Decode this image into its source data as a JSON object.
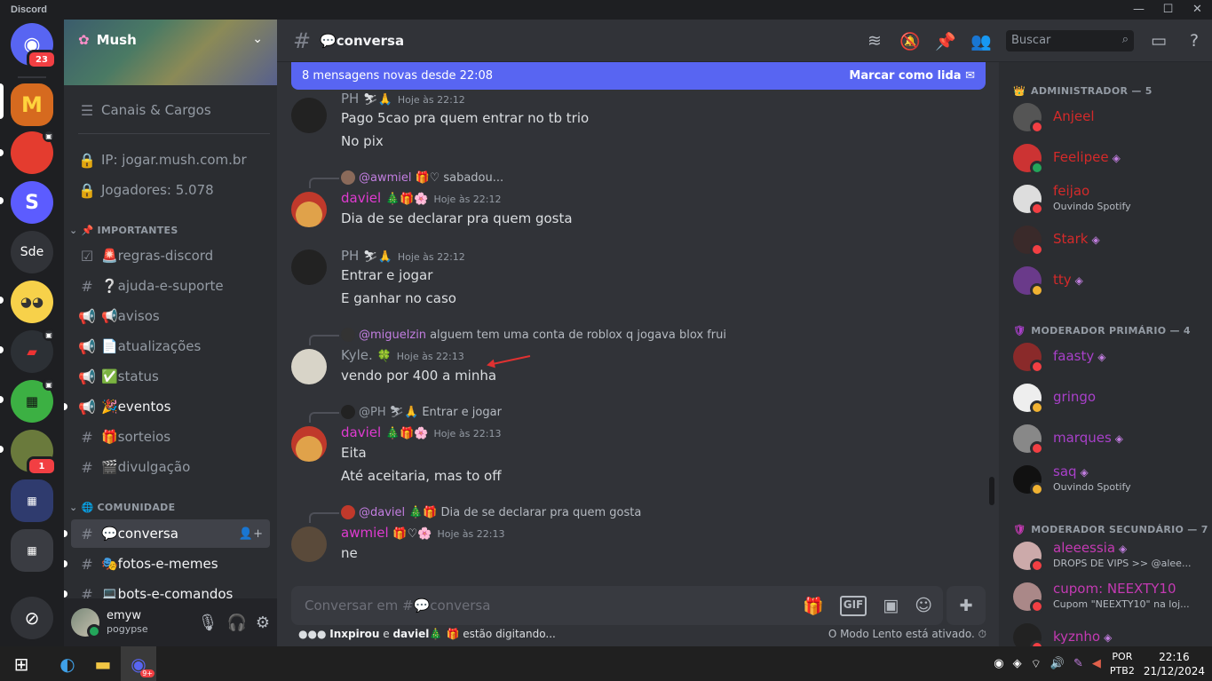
{
  "app": {
    "title": "Discord",
    "window_controls": [
      "—",
      "☐",
      "✕"
    ]
  },
  "rail": {
    "home_badge": "23",
    "servers": [
      {
        "name": "Mush",
        "label": "M",
        "color": "#e8a33b"
      },
      {
        "name": "server-red",
        "label": "",
        "color": "#e43c2f"
      },
      {
        "name": "server-s",
        "label": "S",
        "color": "#5c5cff"
      },
      {
        "name": "Sde",
        "label": "Sde",
        "color": "#313338"
      },
      {
        "name": "server-emoji",
        "label": "",
        "color": "#f7d14a"
      },
      {
        "name": "server-dark-red",
        "label": "",
        "color": "#3b3f45"
      },
      {
        "name": "server-creeper",
        "label": "",
        "color": "#3cb043"
      },
      {
        "name": "server-wild",
        "label": "",
        "color": "#6a7a3c",
        "badge": "1"
      },
      {
        "name": "server-folder-1",
        "label": "",
        "color": "#2f3b6e"
      },
      {
        "name": "server-folder-2",
        "label": "",
        "color": "#2b2d31"
      },
      {
        "name": "explore",
        "label": "",
        "color": "#313338"
      }
    ]
  },
  "server": {
    "name": "Mush",
    "channels_roles": "Canais & Cargos",
    "ip": "IP: jogar.mush.com.br",
    "players": "Jogadores: 5.078",
    "categories": [
      {
        "name": "IMPORTANTES",
        "emoji": "📌"
      },
      {
        "name": "COMUNIDADE",
        "emoji": "🌐"
      }
    ],
    "important_channels": [
      {
        "icon": "☑",
        "name": "🚨regras-discord"
      },
      {
        "icon": "#",
        "name": "❔ajuda-e-suporte"
      },
      {
        "icon": "📢",
        "name": "📢avisos"
      },
      {
        "icon": "📢",
        "name": "📄atualizações"
      },
      {
        "icon": "📢",
        "name": "✅status"
      },
      {
        "icon": "📢",
        "name": "🎉eventos"
      },
      {
        "icon": "#",
        "name": "🎁sorteios"
      },
      {
        "icon": "#",
        "name": "🎬divulgação"
      }
    ],
    "community_channels": [
      {
        "icon": "#",
        "name": "💬conversa"
      },
      {
        "icon": "#",
        "name": "🎭fotos-e-memes"
      },
      {
        "icon": "#",
        "name": "💻bots-e-comandos"
      }
    ]
  },
  "user": {
    "name": "emyw",
    "status": "pogypse"
  },
  "header": {
    "channel": "💬conversa",
    "search_placeholder": "Buscar"
  },
  "newbar": {
    "text": "8 mensagens novas desde 22:08",
    "action": "Marcar como lida"
  },
  "messages": [
    {
      "author": "PH",
      "badges": "⛷🙏",
      "time": "Hoje às 22:12",
      "color": "#949ba4",
      "lines": [
        "Pago 5cao pra quem entrar no tb trio",
        "No pix"
      ]
    },
    {
      "reply_to": "@awmiel",
      "reply_badges": "🎁♡",
      "reply_text": "sabadou...",
      "author": "daviel",
      "badges": "🎄🎁🌸",
      "time": "Hoje às 22:12",
      "color": "#e03bd1",
      "lines": [
        "Dia de se declarar pra quem gosta"
      ]
    },
    {
      "author": "PH",
      "badges": "⛷🙏",
      "time": "Hoje às 22:12",
      "color": "#949ba4",
      "lines": [
        "Entrar e jogar",
        "E ganhar no caso"
      ]
    },
    {
      "reply_to": "@miguelzin",
      "reply_badges": "",
      "reply_text": "alguem tem uma conta de roblox q jogava blox frui",
      "author": "Kyle.",
      "badges": "🍀",
      "time": "Hoje às 22:13",
      "color": "#949ba4",
      "lines": [
        "vendo por 400 a minha"
      ]
    },
    {
      "reply_to": "@PH",
      "reply_badges": "⛷🙏",
      "reply_text": "Entrar e jogar",
      "author": "daviel",
      "badges": "🎄🎁🌸",
      "time": "Hoje às 22:13",
      "color": "#e03bd1",
      "lines": [
        "Eita",
        "Até aceitaria, mas to off"
      ]
    },
    {
      "reply_to": "@daviel",
      "reply_badges": "🎄🎁",
      "reply_text": "Dia de se declarar pra quem gosta",
      "author": "awmiel",
      "badges": "🎁♡🌸",
      "time": "Hoje às 22:13",
      "color": "#e03bd1",
      "lines": [
        "ne"
      ]
    }
  ],
  "composer": {
    "placeholder": "Conversar em #💬conversa",
    "gif": "GIF"
  },
  "typing": {
    "users_a": "Inxpirou",
    "conj": "e",
    "users_b": "daviel🎄 🎁",
    "suffix": "estão digitando...",
    "slow": "O Modo Lento está ativado."
  },
  "members": {
    "groups": [
      {
        "title": "ADMINISTRADOR — 5",
        "icon": "👑",
        "color": "#d42a2a",
        "items": [
          {
            "name": "Anjeel",
            "status": "",
            "state": "dnd",
            "gem": false
          },
          {
            "name": "Feelipee",
            "status": "",
            "state": "online",
            "gem": true
          },
          {
            "name": "feijao",
            "status": "Ouvindo Spotify",
            "state": "dnd",
            "gem": false
          },
          {
            "name": "Stark",
            "status": "",
            "state": "dnd",
            "gem": true
          },
          {
            "name": "tty",
            "status": "",
            "state": "idle",
            "gem": true
          }
        ]
      },
      {
        "title": "MODERADOR PRIMÁRIO — 4",
        "icon": "🛡",
        "color": "#a840c9",
        "items": [
          {
            "name": "faasty",
            "status": "",
            "state": "dnd",
            "gem": true
          },
          {
            "name": "gringo",
            "status": "",
            "state": "idle",
            "gem": false
          },
          {
            "name": "marques",
            "status": "",
            "state": "dnd",
            "gem": true
          },
          {
            "name": "saq",
            "status": "Ouvindo Spotify",
            "state": "idle",
            "gem": true
          }
        ]
      },
      {
        "title": "MODERADOR SECUNDÁRIO — 7",
        "icon": "🛡",
        "color": "#c43ab3",
        "items": [
          {
            "name": "aleeessia",
            "status": "DROPS DE VIPS >> @alee...",
            "state": "dnd",
            "gem": true
          },
          {
            "name": "cupom: NEEXTY10",
            "status": "Cupom \"NEEXTY10\" na loj...",
            "state": "dnd",
            "gem": false
          },
          {
            "name": "kyznho",
            "status": "",
            "state": "dnd",
            "gem": true
          }
        ]
      }
    ]
  },
  "taskbar": {
    "lang1": "POR",
    "lang2": "PTB2",
    "time": "22:16",
    "date": "21/12/2024",
    "discord_badge": "9+"
  }
}
